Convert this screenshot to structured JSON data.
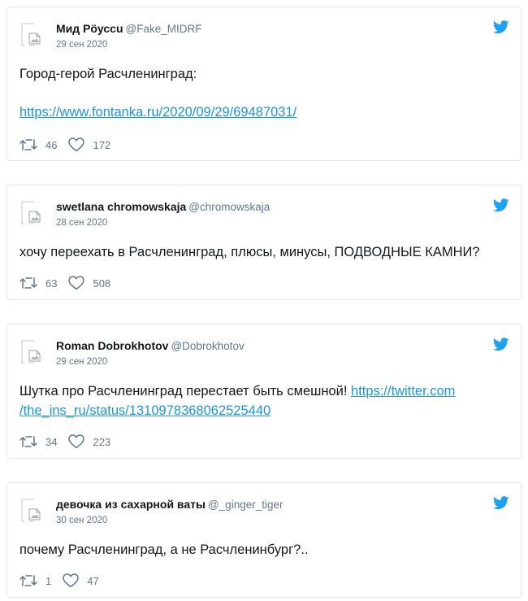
{
  "colors": {
    "accent": "#1da1f2",
    "link": "#1b95e0",
    "muted": "#657786"
  },
  "icons": {
    "avatar": "broken-image-icon",
    "bird": "twitter-bird-icon",
    "retweet": "retweet-icon",
    "like": "heart-icon"
  },
  "tweets": [
    {
      "name": "Мид Рöуссu",
      "handle": "@Fake_MIDRF",
      "date": "29 сен 2020",
      "text": "Город-герой Расчленинград:",
      "link": "https://www.fontanka.ru/2020/09/29/69487031/",
      "retweets": "46",
      "likes": "172"
    },
    {
      "name": "swetlana chromowskaja",
      "handle": "@chromowskaja",
      "date": "28 сен 2020",
      "text": "хочу переехать в Расчленинград, плюсы, минусы, ПОДВОДНЫЕ КАМНИ?",
      "retweets": "63",
      "likes": "508"
    },
    {
      "name": "Roman Dobrokhotov",
      "handle": "@Dobrokhotov",
      "date": "29 сен 2020",
      "text": "Шутка про Расчленинград перестает быть смешной!",
      "link_line1": "https://twitter.com",
      "link_line2": "/the_ins_ru/status/1310978368062525440",
      "retweets": "34",
      "likes": "223"
    },
    {
      "name": "девочка из сахарной ваты",
      "handle": "@_ginger_tiger",
      "date": "30 сен 2020",
      "text": "почему Расчленинград, а не Расчленинбург?..",
      "retweets": "1",
      "likes": "47"
    }
  ]
}
